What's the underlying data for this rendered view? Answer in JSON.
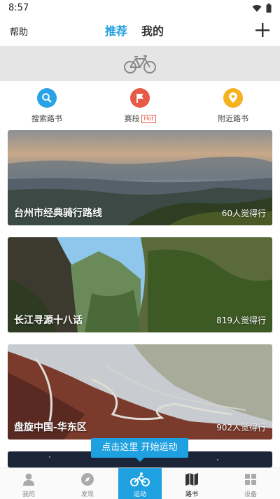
{
  "status_bar": {
    "time": "8:57"
  },
  "header": {
    "help_label": "帮助",
    "tabs": [
      {
        "label": "推荐",
        "active": true
      },
      {
        "label": "我的",
        "active": false
      }
    ]
  },
  "quick_actions": [
    {
      "label": "搜索路书",
      "icon": "search-icon",
      "color": "#2aa3e6"
    },
    {
      "label": "赛段",
      "badge": "Hot",
      "icon": "flag-icon",
      "color": "#e85a48"
    },
    {
      "label": "附近路书",
      "icon": "location-pin-icon",
      "color": "#f5b21e"
    }
  ],
  "routes": [
    {
      "title": "台州市经典骑行路线",
      "count": "60人觉得行"
    },
    {
      "title": "长江寻源十八话",
      "count": "819人觉得行"
    },
    {
      "title": "盘旋中国-华东区",
      "count": "902人觉得行"
    }
  ],
  "tooltip": "点击这里 开始运动",
  "bottom_nav": [
    {
      "label": "我的",
      "icon": "person-icon"
    },
    {
      "label": "发现",
      "icon": "compass-icon"
    },
    {
      "label": "运动",
      "icon": "bike-icon",
      "active": true
    },
    {
      "label": "路书",
      "icon": "map-icon"
    },
    {
      "label": "设备",
      "icon": "grid-icon"
    }
  ]
}
